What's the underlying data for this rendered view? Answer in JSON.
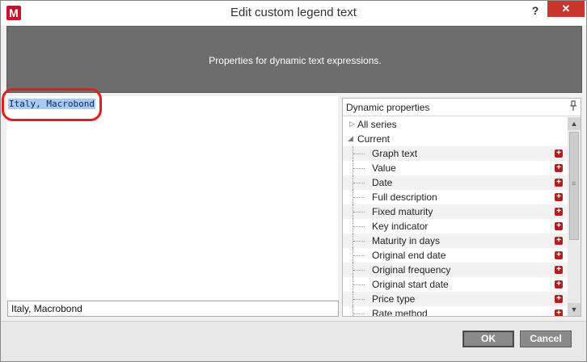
{
  "window": {
    "logo": "M",
    "title": "Edit custom legend text",
    "help": "?",
    "close": "✕"
  },
  "banner": {
    "text": "Properties for dynamic text expressions."
  },
  "editor": {
    "value": "Italy, Macrobond"
  },
  "preview": {
    "value": "Italy, Macrobond"
  },
  "props": {
    "title": "Dynamic properties",
    "pin_icon": "pin-icon",
    "groups": [
      {
        "label": "All series",
        "expanded": false
      },
      {
        "label": "Current",
        "expanded": true
      }
    ],
    "items": [
      "Graph text",
      "Value",
      "Date",
      "Full description",
      "Fixed maturity",
      "Key indicator",
      "Maturity in days",
      "Original end date",
      "Original frequency",
      "Original start date",
      "Price type",
      "Rate method"
    ],
    "add_icon": "plus-icon"
  },
  "footer": {
    "ok_label": "OK",
    "cancel_label": "Cancel"
  },
  "colors": {
    "banner": "#6d6d6d",
    "close": "#c7372f",
    "highlight": "#a9c9ef",
    "annotation": "#e0201c",
    "plus": "#b51c1c"
  }
}
